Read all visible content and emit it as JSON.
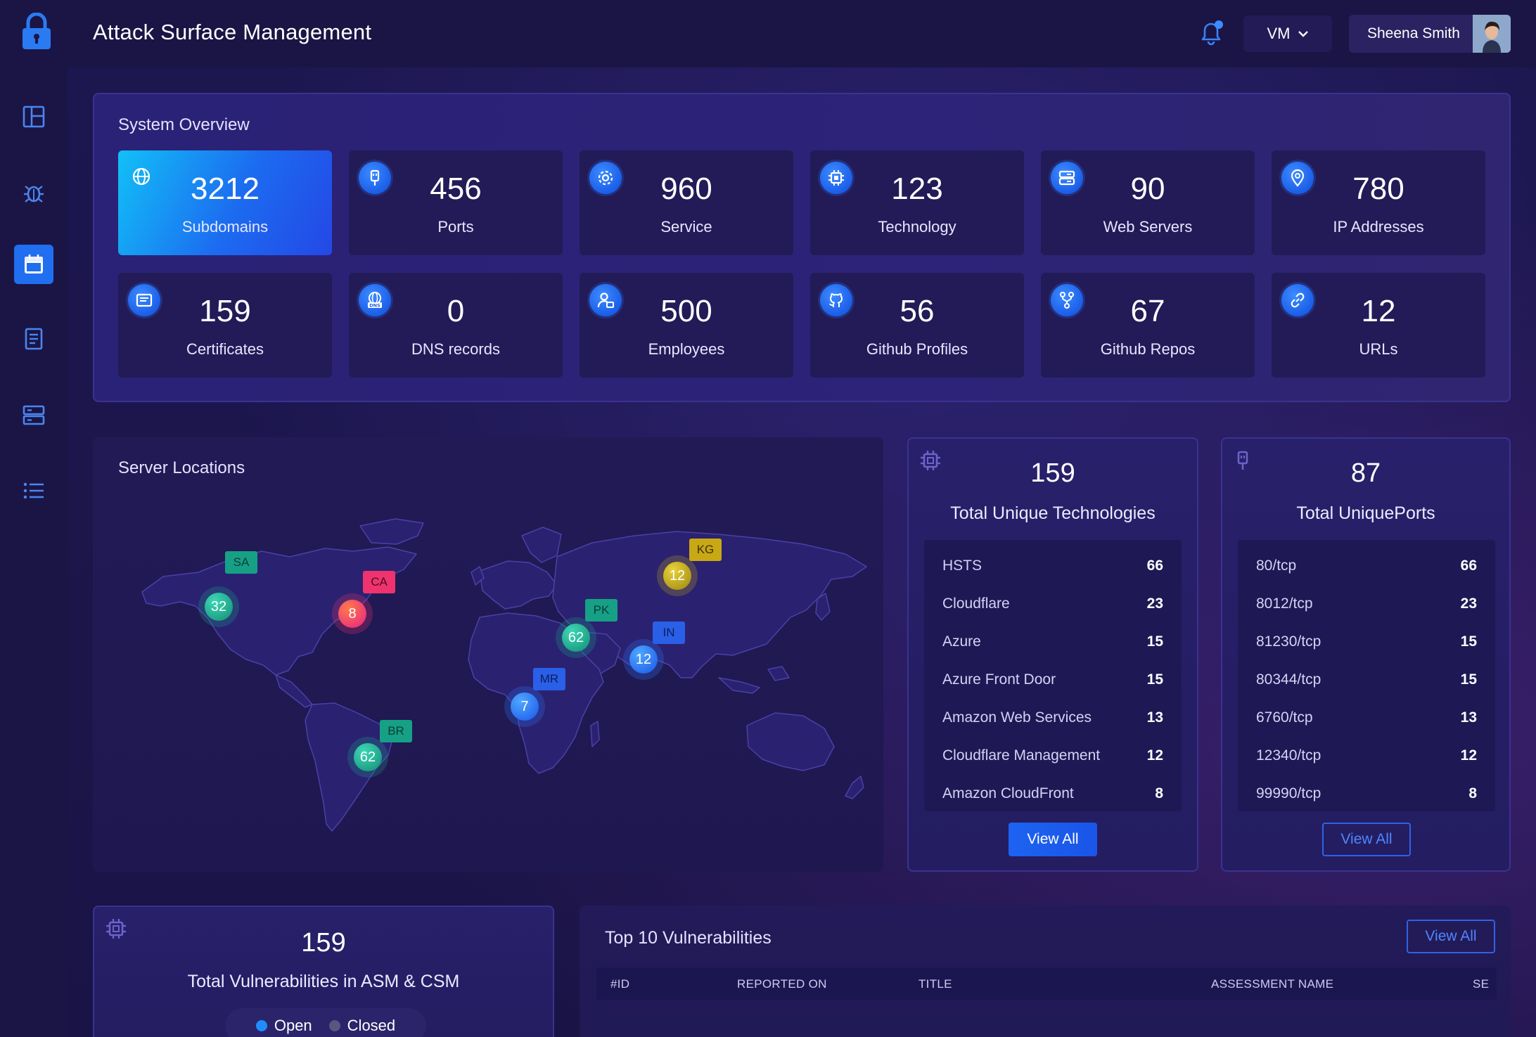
{
  "app": {
    "title": "Attack Surface Management"
  },
  "header": {
    "vm_label": "VM",
    "user_name": "Sheena Smith"
  },
  "sidebar": {
    "items": [
      {
        "name": "dashboard",
        "icon": "layout-icon"
      },
      {
        "name": "bugs",
        "icon": "bug-icon"
      },
      {
        "name": "calendar",
        "icon": "calendar-icon",
        "active": true
      },
      {
        "name": "reports",
        "icon": "report-icon"
      },
      {
        "name": "servers",
        "icon": "server-icon"
      },
      {
        "name": "list",
        "icon": "list-icon"
      }
    ]
  },
  "overview": {
    "title": "System Overview",
    "stats": [
      {
        "value": "3212",
        "label": "Subdomains",
        "icon": "globe-icon"
      },
      {
        "value": "456",
        "label": "Ports",
        "icon": "plug-icon"
      },
      {
        "value": "960",
        "label": "Service",
        "icon": "gear-icon"
      },
      {
        "value": "123",
        "label": "Technology",
        "icon": "chip-icon"
      },
      {
        "value": "90",
        "label": "Web Servers",
        "icon": "server-icon"
      },
      {
        "value": "780",
        "label": "IP Addresses",
        "icon": "location-pin-icon"
      },
      {
        "value": "159",
        "label": "Certificates",
        "icon": "certificate-icon"
      },
      {
        "value": "0",
        "label": "DNS records",
        "icon": "dns-icon"
      },
      {
        "value": "500",
        "label": "Employees",
        "icon": "employee-icon"
      },
      {
        "value": "56",
        "label": "Github Profiles",
        "icon": "github-icon"
      },
      {
        "value": "67",
        "label": "Github Repos",
        "icon": "git-fork-icon"
      },
      {
        "value": "12",
        "label": "URLs",
        "icon": "link-icon"
      }
    ]
  },
  "servers": {
    "title": "Server Locations",
    "markers": [
      {
        "code": "SA",
        "count": "32",
        "color": "#1aa58c"
      },
      {
        "code": "CA",
        "count": "8",
        "color": "#f0336e"
      },
      {
        "code": "BR",
        "count": "62",
        "color": "#1aa58c"
      },
      {
        "code": "PK",
        "count": "62",
        "color": "#1aa58c"
      },
      {
        "code": "MR",
        "count": "7",
        "color": "#2a6ff0"
      },
      {
        "code": "IN",
        "count": "12",
        "color": "#2a6ff0"
      },
      {
        "code": "KG",
        "count": "12",
        "color": "#c8a814"
      }
    ]
  },
  "technologies": {
    "total": "159",
    "title": "Total Unique Technologies",
    "rows": [
      {
        "name": "HSTS",
        "value": "66"
      },
      {
        "name": "Cloudflare",
        "value": "23"
      },
      {
        "name": "Azure",
        "value": "15"
      },
      {
        "name": "Azure Front Door",
        "value": "15"
      },
      {
        "name": "Amazon Web Services",
        "value": "13"
      },
      {
        "name": "Cloudflare Management",
        "value": "12"
      },
      {
        "name": "Amazon CloudFront",
        "value": "8"
      }
    ],
    "button": "View All"
  },
  "ports": {
    "total": "87",
    "title": "Total UniquePorts",
    "rows": [
      {
        "name": "80/tcp",
        "value": "66"
      },
      {
        "name": "8012/tcp",
        "value": "23"
      },
      {
        "name": "81230/tcp",
        "value": "15"
      },
      {
        "name": "80344/tcp",
        "value": "15"
      },
      {
        "name": "6760/tcp",
        "value": "13"
      },
      {
        "name": "12340/tcp",
        "value": "12"
      },
      {
        "name": "99990/tcp",
        "value": "8"
      }
    ],
    "button": "View All"
  },
  "vulnerabilities": {
    "total": "159",
    "title": "Total Vulnerabilities in ASM & CSM",
    "legend_open": "Open",
    "legend_closed": "Closed",
    "open_color": "#1f8cff",
    "closed_color": "#5b5580"
  },
  "top10": {
    "title": "Top 10 Vulnerabilities",
    "button": "View All",
    "columns": [
      "#ID",
      "REPORTED ON",
      "TITLE",
      "ASSESSMENT NAME",
      "SE"
    ]
  }
}
